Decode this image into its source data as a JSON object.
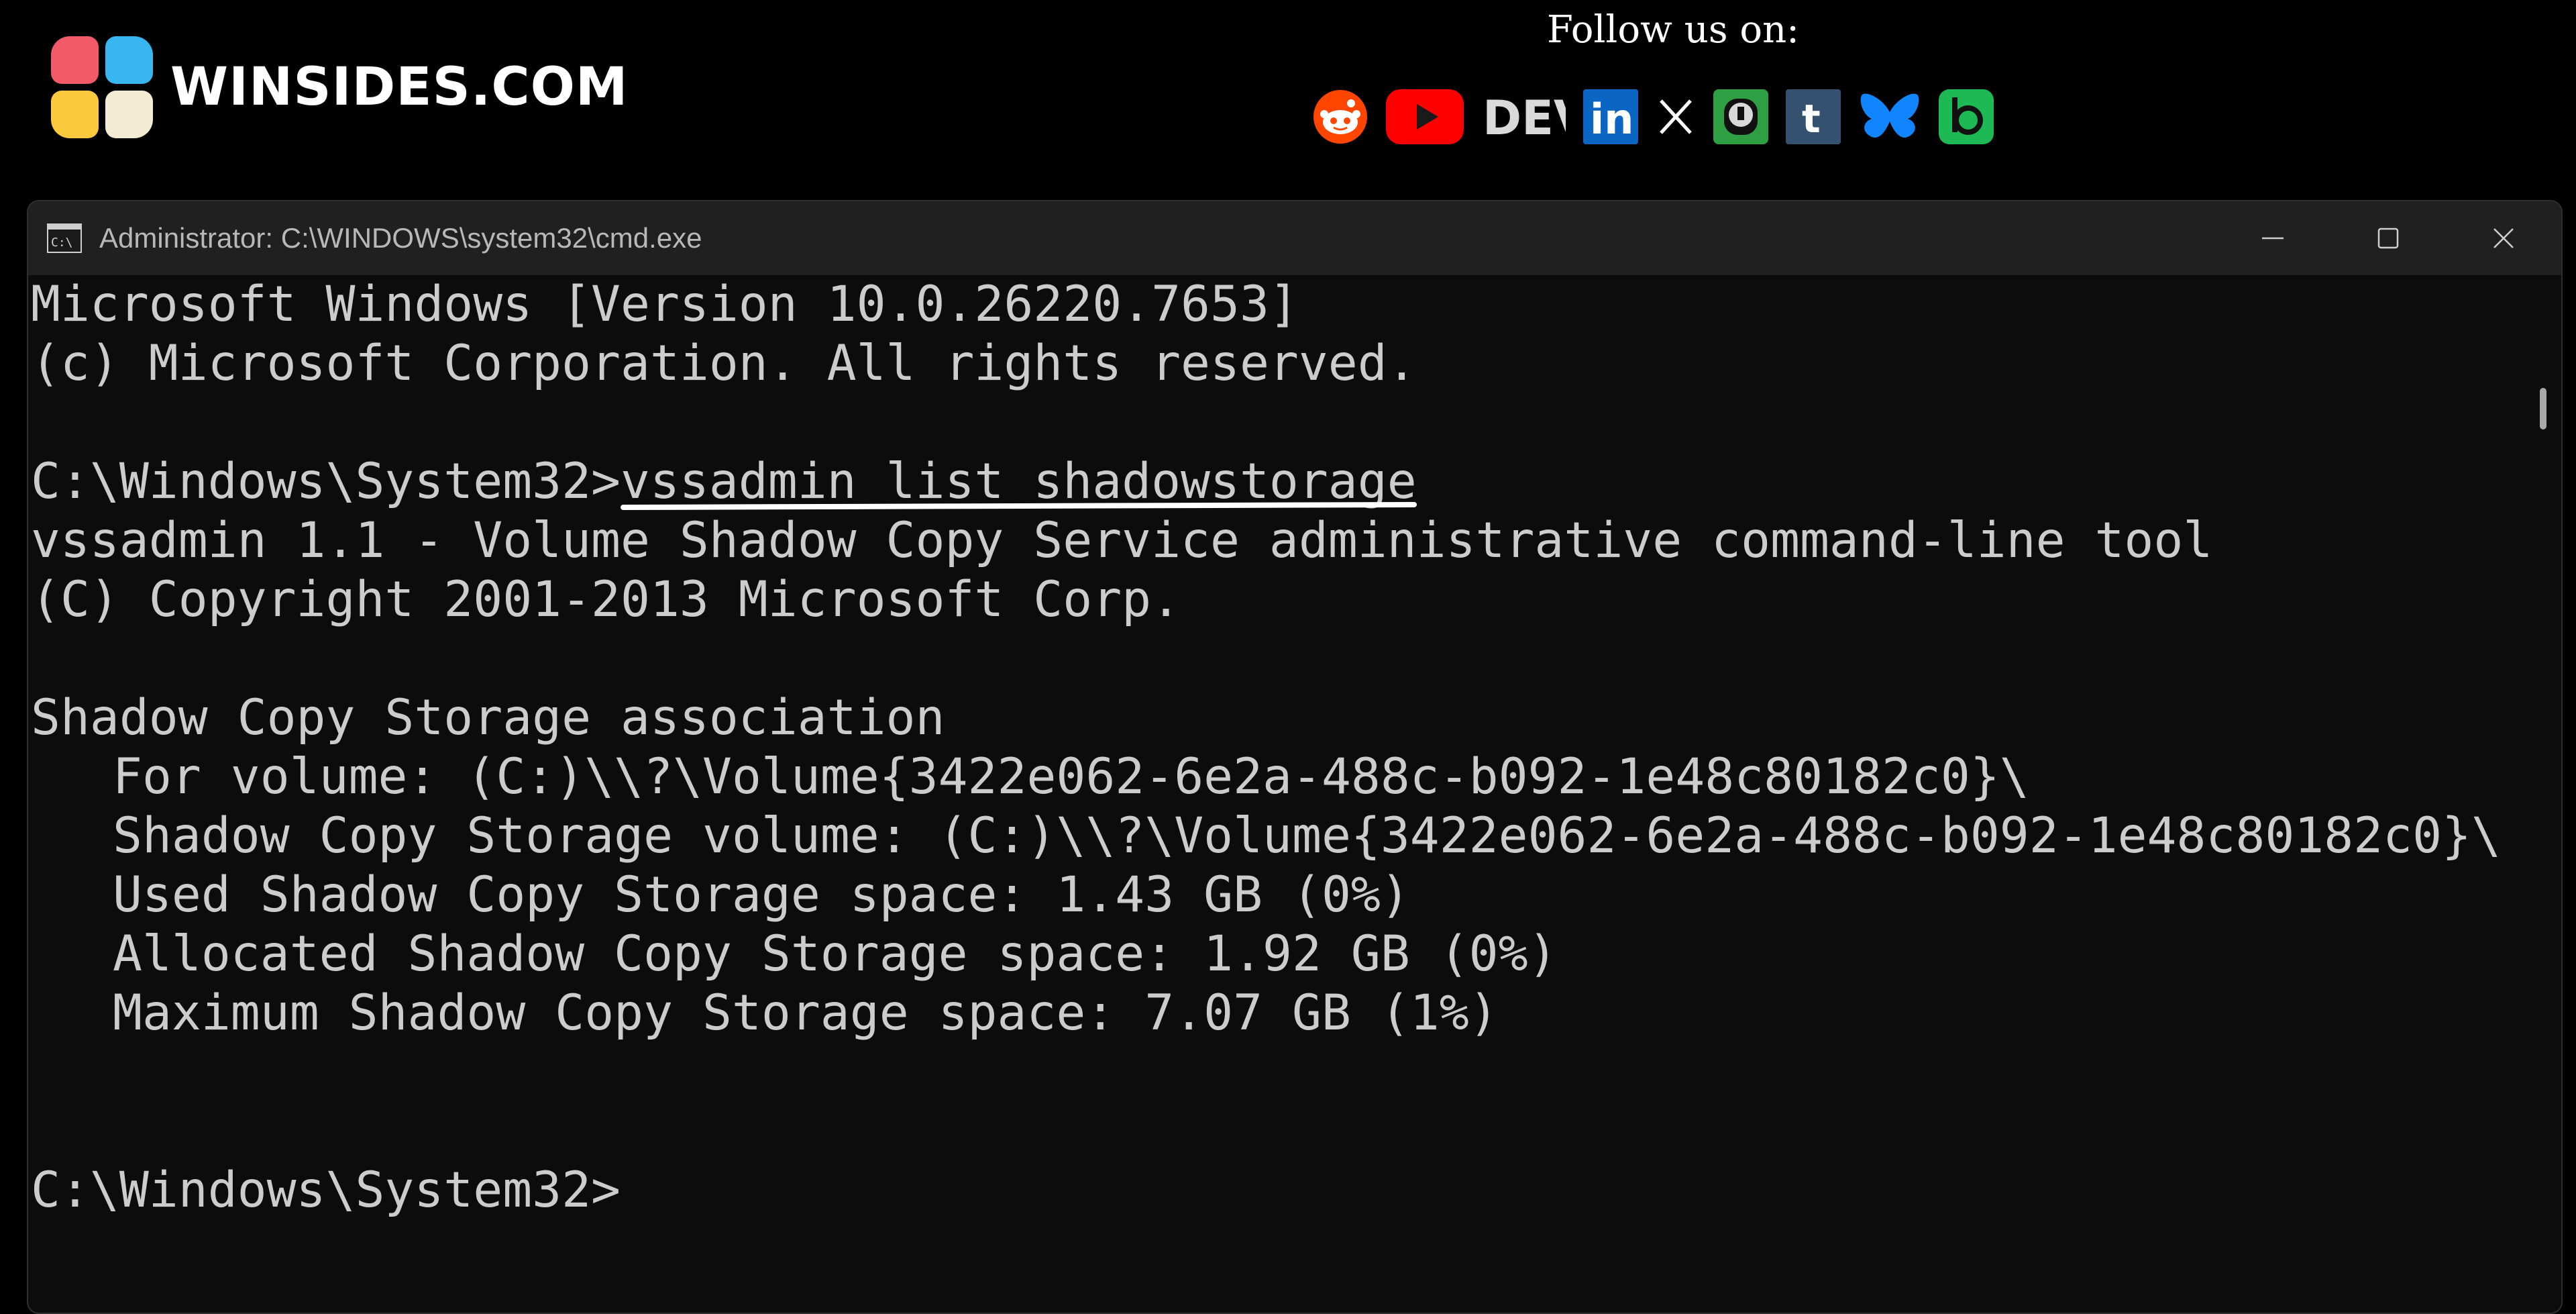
{
  "brand": {
    "name": "WINSIDES.COM",
    "logo_colors": [
      "#f25a67",
      "#38b6f0",
      "#fbc93d",
      "#f4ecd2"
    ]
  },
  "follow": {
    "label": "Follow us on:",
    "icons": [
      {
        "name": "reddit-icon",
        "color": "#ff4500"
      },
      {
        "name": "youtube-icon",
        "color": "#ff0000"
      },
      {
        "name": "dev-icon",
        "text": "DEV",
        "color": "#d9d9d9"
      },
      {
        "name": "linkedin-icon",
        "text": "in",
        "color": "#0a66c2"
      },
      {
        "name": "x-icon",
        "color": "#ffffff"
      },
      {
        "name": "mastodon-like-icon",
        "color": "#2ea043"
      },
      {
        "name": "tumblr-icon",
        "text": "t",
        "color": "#34526f"
      },
      {
        "name": "bluesky-icon",
        "color": "#1185fe"
      },
      {
        "name": "bereal-icon",
        "color": "#1db954"
      }
    ]
  },
  "window": {
    "title": "Administrator: C:\\WINDOWS\\system32\\cmd.exe",
    "icon": "cmd-icon"
  },
  "console": {
    "header1": "Microsoft Windows [Version 10.0.26220.7653]",
    "header2": "(c) Microsoft Corporation. All rights reserved.",
    "prompt": "C:\\Windows\\System32>",
    "command": "vssadmin list shadowstorage",
    "out1": "vssadmin 1.1 - Volume Shadow Copy Service administrative command-line tool",
    "out2": "(C) Copyright 2001-2013 Microsoft Corp.",
    "assoc": "Shadow Copy Storage association",
    "for_volume": "For volume: (C:)\\\\?\\Volume{3422e062-6e2a-488c-b092-1e48c80182c0}\\",
    "storage_volume": "Shadow Copy Storage volume: (C:)\\\\?\\Volume{3422e062-6e2a-488c-b092-1e48c80182c0}\\",
    "used": "Used Shadow Copy Storage space: 1.43 GB (0%)",
    "allocated": "Allocated Shadow Copy Storage space: 1.92 GB (0%)",
    "maximum": "Maximum Shadow Copy Storage space: 7.07 GB (1%)",
    "final_prompt": "C:\\Windows\\System32>"
  },
  "colors": {
    "console_bg": "#0c0c0c",
    "console_text": "#cccccc",
    "titlebar_bg": "#202020"
  }
}
